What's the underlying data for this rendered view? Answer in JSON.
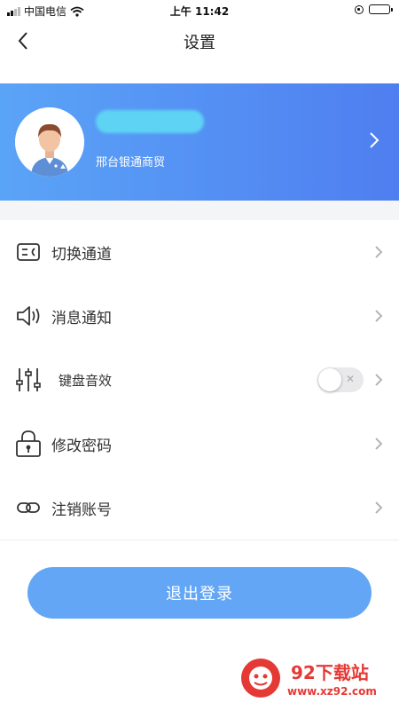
{
  "status_bar": {
    "carrier": "中国电信",
    "time": "上午 11:42",
    "battery_level": 0.7
  },
  "nav": {
    "title": "设置",
    "back_icon": "chevron-left-icon"
  },
  "profile": {
    "company": "邢台银通商贸",
    "gradient": [
      "#5aa4f7",
      "#4f7ef0"
    ]
  },
  "menu": {
    "items": [
      {
        "key": "switch-channel",
        "label": "切换通道",
        "icon": "channel-switch-icon"
      },
      {
        "key": "notifications",
        "label": "消息通知",
        "icon": "speaker-icon"
      },
      {
        "key": "keyboard-sound",
        "label": "键盘音效",
        "icon": "equalizer-icon",
        "toggle": false
      },
      {
        "key": "change-password",
        "label": "修改密码",
        "icon": "lock-icon"
      },
      {
        "key": "deactivate-account",
        "label": "注销账号",
        "icon": "link-icon"
      }
    ]
  },
  "logout": {
    "label": "退出登录",
    "color": "#62a6f5"
  },
  "watermark": {
    "title": "92下载站",
    "url": "www.xz92.com"
  }
}
